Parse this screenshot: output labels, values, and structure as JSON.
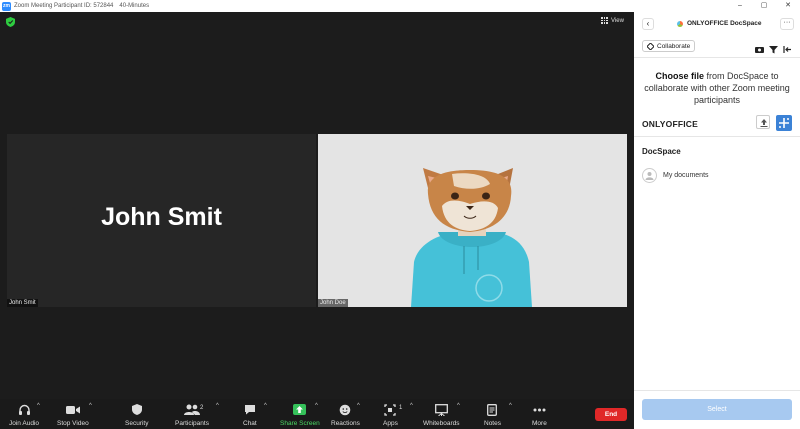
{
  "window": {
    "app_logo": "zm",
    "title": "Zoom Meeting Participant ID: 572844",
    "subtitle": "40-Minutes",
    "controls": [
      "–",
      "▢",
      "✕"
    ]
  },
  "meeting": {
    "view_label": "View",
    "tiles": [
      {
        "big_name": "John Smit",
        "name_tag": "John Smit"
      },
      {
        "name_tag": "John Doe"
      }
    ]
  },
  "toolbar": {
    "items": [
      {
        "label": "Join Audio",
        "icon": "headphones-icon"
      },
      {
        "label": "Stop Video",
        "icon": "video-camera-icon"
      },
      {
        "label": "Security",
        "icon": "shield-icon"
      },
      {
        "label": "Participants",
        "icon": "participants-icon",
        "badge": "2"
      },
      {
        "label": "Chat",
        "icon": "chat-bubble-icon"
      },
      {
        "label": "Share Screen",
        "icon": "share-arrow-icon"
      },
      {
        "label": "Reactions",
        "icon": "reaction-plus-icon"
      },
      {
        "label": "Apps",
        "icon": "apps-icon",
        "badge": "1"
      },
      {
        "label": "Whiteboards",
        "icon": "whiteboard-icon"
      },
      {
        "label": "Notes",
        "icon": "notes-icon"
      },
      {
        "label": "More",
        "icon": "more-dots-icon"
      }
    ],
    "end_label": "End",
    "share_color": "#4cd964",
    "end_color": "#e02828"
  },
  "panel": {
    "back": "‹",
    "title": "ONLYOFFICE DocSpace",
    "more": "···",
    "collaborate_label": "Collaborate",
    "choose_bold": "Choose file",
    "choose_rest": " from DocSpace to collaborate with other Zoom meeting participants",
    "onlyoffice_heading": "ONLYOFFICE",
    "docspace_heading": "DocSpace",
    "my_documents": "My documents",
    "select_label": "Select",
    "accent_color": "#3b82d6"
  }
}
